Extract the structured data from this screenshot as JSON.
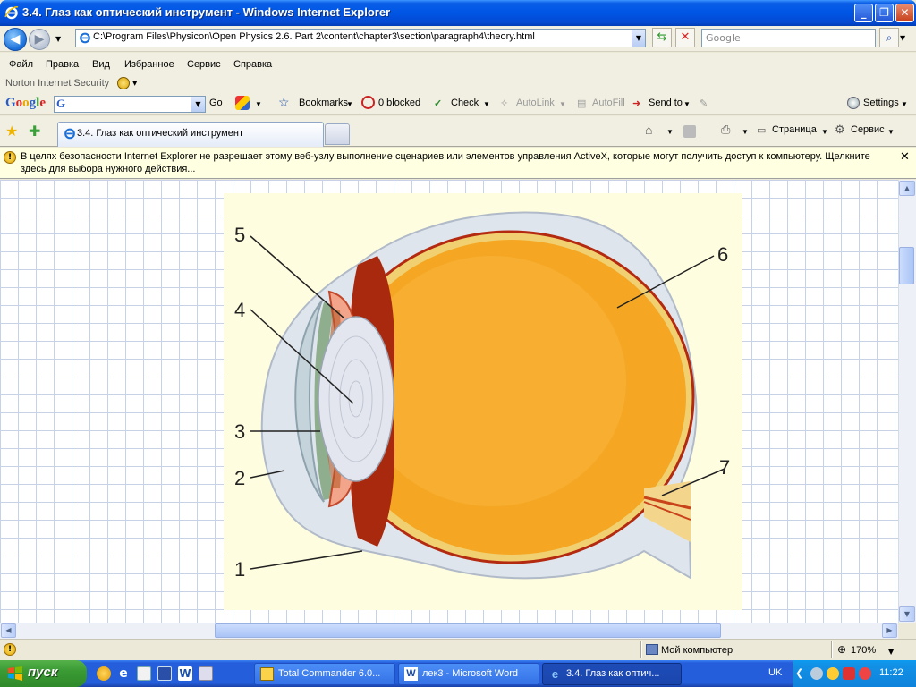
{
  "window": {
    "title": "3.4. Глаз как оптический инструмент - Windows Internet Explorer"
  },
  "address_bar": {
    "url": "C:\\Program Files\\Physicon\\Open Physics 2.6. Part 2\\content\\chapter3\\section\\paragraph4\\theory.html",
    "search_placeholder": "Google"
  },
  "menu": {
    "items": [
      "Файл",
      "Правка",
      "Вид",
      "Избранное",
      "Сервис",
      "Справка"
    ]
  },
  "norton": {
    "label": "Norton Internet Security"
  },
  "google_toolbar": {
    "logo": "Google",
    "go": "Go",
    "bookmarks": "Bookmarks",
    "blocked": "0 blocked",
    "check": "Check",
    "autolink": "AutoLink",
    "autofill": "AutoFill",
    "sendto": "Send to",
    "settings": "Settings"
  },
  "tabs": {
    "active_label": "3.4. Глаз как оптический инструмент",
    "page_cmd": "Страница",
    "tools_cmd": "Сервис"
  },
  "infobar": {
    "text": "В целях безопасности Internet Explorer не разрешает этому веб-узлу выполнение сценариев или элементов управления ActiveX, которые могут получить доступ к компьютеру. Щелкните здесь для выбора нужного действия..."
  },
  "diagram": {
    "labels": [
      "1",
      "2",
      "3",
      "4",
      "5",
      "6",
      "7"
    ]
  },
  "status": {
    "zone": "Мой компьютер",
    "zoom": "170%"
  },
  "taskbar": {
    "start": "пуск",
    "tasks": [
      "Total Commander 6.0...",
      "лек3 - Microsoft Word",
      "3.4. Глаз как оптич..."
    ],
    "lang": "UK",
    "time": "11:22"
  }
}
